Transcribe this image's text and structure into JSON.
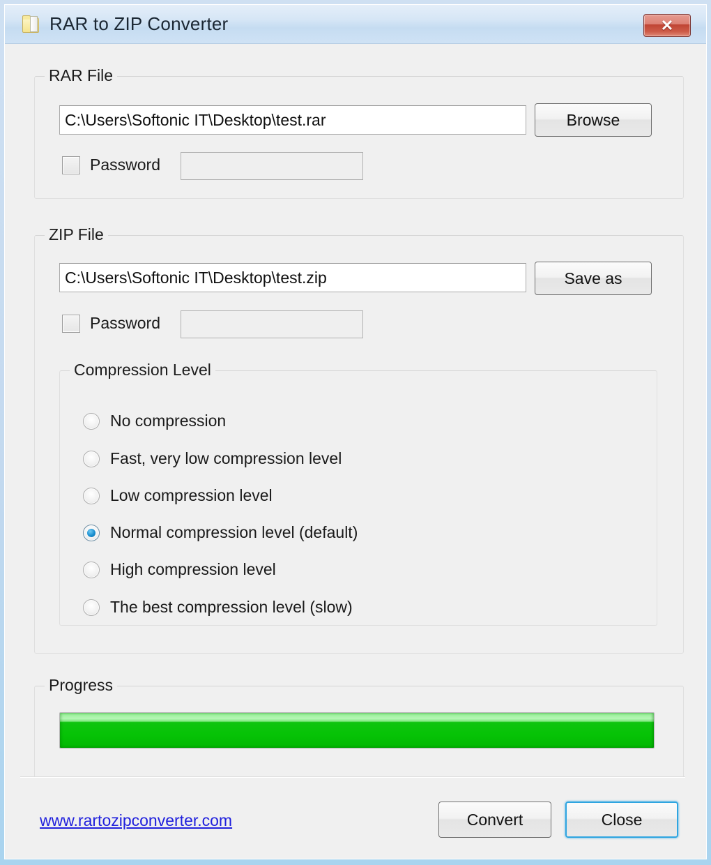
{
  "window": {
    "title": "RAR to ZIP Converter",
    "icon": "folder-icon",
    "close_label": "✕"
  },
  "rar_section": {
    "legend": "RAR File",
    "path_value": "C:\\Users\\Softonic IT\\Desktop\\test.rar",
    "path_placeholder": "",
    "browse_label": "Browse",
    "password_label": "Password",
    "password_value": "",
    "password_placeholder": "",
    "password_checked": false
  },
  "zip_section": {
    "legend": "ZIP File",
    "path_value": "C:\\Users\\Softonic IT\\Desktop\\test.zip",
    "path_placeholder": "",
    "save_as_label": "Save as",
    "password_label": "Password",
    "password_value": "",
    "password_placeholder": "",
    "password_checked": false
  },
  "compression": {
    "legend": "Compression Level",
    "selected_index": 3,
    "options": [
      {
        "label": "No compression"
      },
      {
        "label": "Fast, very low compression level"
      },
      {
        "label": "Low compression level"
      },
      {
        "label": "Normal compression level (default)"
      },
      {
        "label": "High compression level"
      },
      {
        "label": "The best compression level (slow)"
      }
    ]
  },
  "progress": {
    "legend": "Progress",
    "percent": 100,
    "fill_color": "#06c306"
  },
  "footer": {
    "link_text": "www.rartozipconverter.com",
    "convert_label": "Convert",
    "close_label": "Close"
  },
  "colors": {
    "titlebar_top": "#e4eef9",
    "titlebar_bottom": "#cfe2f5",
    "frame": "#c3d9ef",
    "dialog_bg": "#f0f0f0",
    "close_button": "#bf4434",
    "focus_border": "#2fa5e0",
    "link": "#2020dd"
  }
}
